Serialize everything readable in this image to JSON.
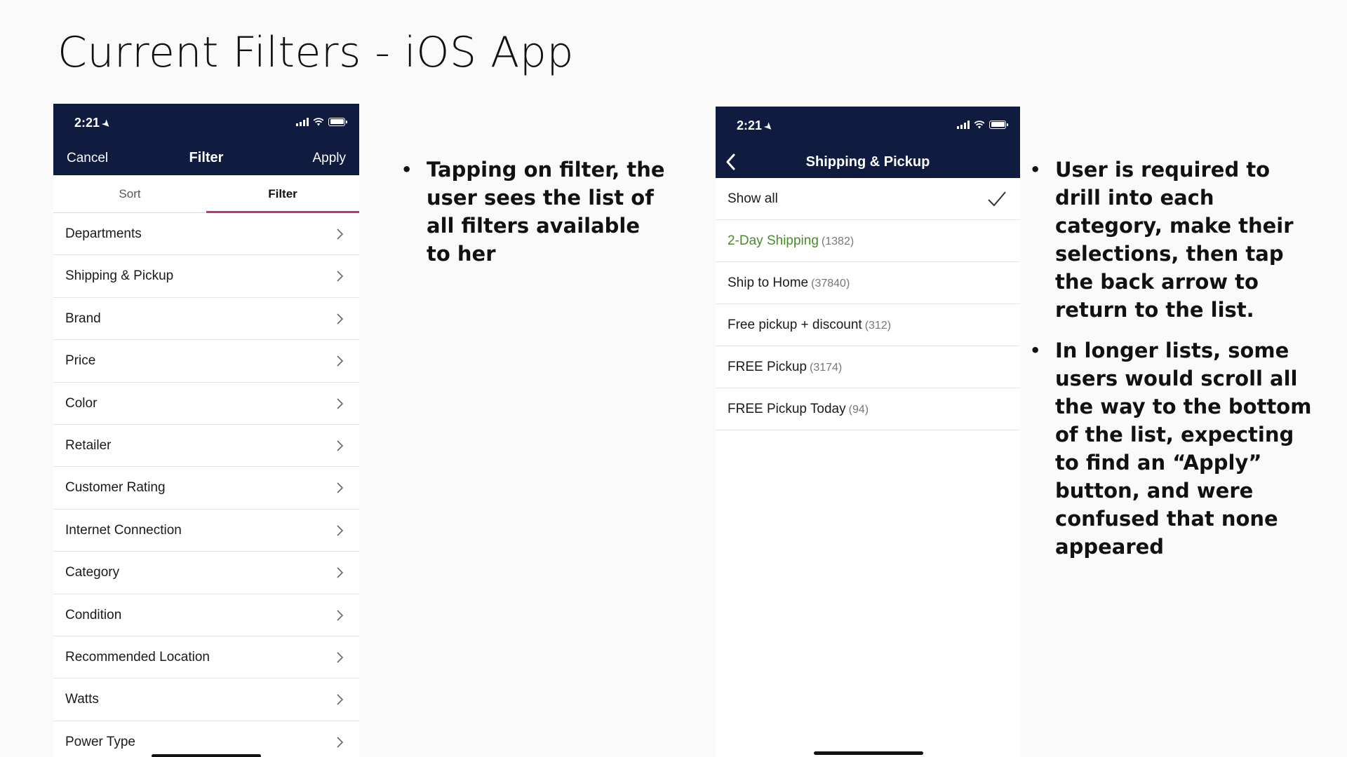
{
  "slide": {
    "title": "Current Filters - iOS App",
    "left_notes": [
      "Tapping on filter, the user sees the list of all filters available to her"
    ],
    "right_notes": [
      "User is required to drill into each category, make their selections, then tap the back arrow to return to the list.",
      "In longer lists, some users would scroll all the way to the bottom of the list, expecting to find an “Apply” button, and were confused that none appeared"
    ]
  },
  "left_phone": {
    "status_time": "2:21",
    "nav": {
      "cancel": "Cancel",
      "title": "Filter",
      "apply": "Apply"
    },
    "tabs": [
      {
        "label": "Sort"
      },
      {
        "label": "Filter"
      }
    ],
    "selected_tab": "Filter",
    "items": [
      {
        "label": "Departments"
      },
      {
        "label": "Shipping & Pickup"
      },
      {
        "label": "Brand"
      },
      {
        "label": "Price"
      },
      {
        "label": "Color"
      },
      {
        "label": "Retailer"
      },
      {
        "label": "Customer Rating"
      },
      {
        "label": "Internet Connection"
      },
      {
        "label": "Category"
      },
      {
        "label": "Condition"
      },
      {
        "label": "Recommended Location"
      },
      {
        "label": "Watts"
      },
      {
        "label": "Power Type"
      }
    ]
  },
  "right_phone": {
    "status_time": "2:21",
    "title": "Shipping & Pickup",
    "options": [
      {
        "label": "Show all",
        "count": "",
        "selected": true
      },
      {
        "label": "2-Day Shipping",
        "count": "(1382)",
        "selected": false
      },
      {
        "label": "Ship to Home",
        "count": "(37840)",
        "selected": false
      },
      {
        "label": "Free pickup + discount",
        "count": "(312)",
        "selected": false
      },
      {
        "label": "FREE Pickup",
        "count": "(3174)",
        "selected": false
      },
      {
        "label": "FREE Pickup Today",
        "count": "(94)",
        "selected": false
      }
    ]
  },
  "colors": {
    "nav_bg": "#0f1c3f",
    "tab_accent": "#c2347a",
    "highlight_green": "#4a8a2a"
  }
}
